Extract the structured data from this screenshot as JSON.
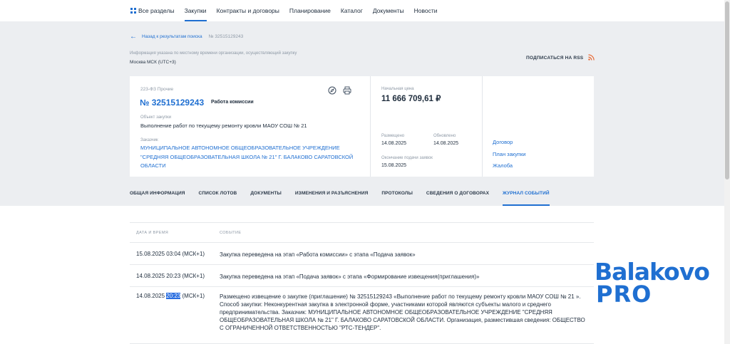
{
  "nav": {
    "items": [
      {
        "label": "Все разделы",
        "icon": "grid-icon"
      },
      {
        "label": "Закупки",
        "active": true
      },
      {
        "label": "Контракты и договоры"
      },
      {
        "label": "Планирование"
      },
      {
        "label": "Каталог"
      },
      {
        "label": "Документы"
      },
      {
        "label": "Новости"
      }
    ]
  },
  "breadcrumb": {
    "back_label": "Назад к результатам поиска",
    "current": "№ 32515129243"
  },
  "timezone": {
    "info": "Информация указана по местному времени организации, осуществляющий закупку",
    "value": "Москва МСК (UTC+3)"
  },
  "rss_label": "ПОДПИСАТЬСЯ НА RSS",
  "purchase": {
    "law": "223-ФЗ Прочие",
    "number": "№ 32515129243",
    "stage": "Работа комиссии",
    "object_label": "Объект закупки",
    "object_text": "Выполнение работ по текущему ремонту кровли МАОУ СОШ № 21",
    "customer_label": "Заказчик",
    "customer_name": "МУНИЦИПАЛЬНОЕ АВТОНОМНОЕ ОБЩЕОБРАЗОВАТЕЛЬНОЕ УЧРЕЖДЕНИЕ \"СРЕДНЯЯ ОБЩЕОБРАЗОВАТЕЛЬНАЯ ШКОЛА № 21\" Г. БАЛАКОВО САРАТОВСКОЙ ОБЛАСТИ",
    "price_label": "Начальная цена",
    "price": "11 666 709,61 ₽",
    "posted_label": "Размещено",
    "posted": "14.08.2025",
    "updated_label": "Обновлено",
    "updated": "14.08.2025",
    "deadline_label": "Окончание подачи заявок",
    "deadline": "15.08.2025",
    "links": [
      "Договор",
      "План закупки",
      "Жалоба"
    ]
  },
  "tabs": [
    {
      "label": "ОБЩАЯ ИНФОРМАЦИЯ"
    },
    {
      "label": "СПИСОК ЛОТОВ"
    },
    {
      "label": "ДОКУМЕНТЫ"
    },
    {
      "label": "ИЗМЕНЕНИЯ И РАЗЪЯСНЕНИЯ"
    },
    {
      "label": "ПРОТОКОЛЫ"
    },
    {
      "label": "СВЕДЕНИЯ О ДОГОВОРАХ"
    },
    {
      "label": "ЖУРНАЛ СОБЫТИЙ",
      "active": true
    }
  ],
  "journal": {
    "col_date": "ДАТА И ВРЕМЯ",
    "col_event": "СОБЫТИЕ",
    "rows": [
      {
        "date": "15.08.2025 03:04 (МСК+1)",
        "event": "Закупка переведена на этап «Работа комиссии» с этапа «Подача заявок»"
      },
      {
        "date": "14.08.2025 20:23 (МСК+1)",
        "event": "Закупка переведена на этап «Подача заявок» с этапа «Формирование извещения(приглашения)»"
      },
      {
        "date_prefix": "14.08.2025 ",
        "date_highlight": "20:23",
        "date_suffix": " (МСК+1)",
        "event": "Размещено извещение о закупке (приглашение) № 32515129243 «Выполнение работ по текущему ремонту кровли МАОУ СОШ № 21 ». Способ закупки: Неконкурентная закупка в электронной форме, участниками которой являются субъекты малого и среднего предпринимательства. Заказчик: МУНИЦИПАЛЬНОЕ АВТОНОМНОЕ ОБЩЕОБРАЗОВАТЕЛЬНОЕ УЧРЕЖДЕНИЕ \"СРЕДНЯЯ ОБЩЕОБРАЗОВАТЕЛЬНАЯ ШКОЛА № 21\" Г. БАЛАКОВО САРАТОВСКОЙ ОБЛАСТИ. Организация, разместившая сведения: ОБЩЕСТВО С ОГРАНИЧЕННОЙ ОТВЕТСТВЕННОСТЬЮ \"РТС-ТЕНДЕР\"."
      }
    ]
  },
  "watermark": {
    "line1": "Balakovo",
    "line2": "PRO"
  },
  "colors": {
    "accent": "#1f6fd1",
    "background_band": "#eceef1",
    "rss": "#e8632b"
  }
}
